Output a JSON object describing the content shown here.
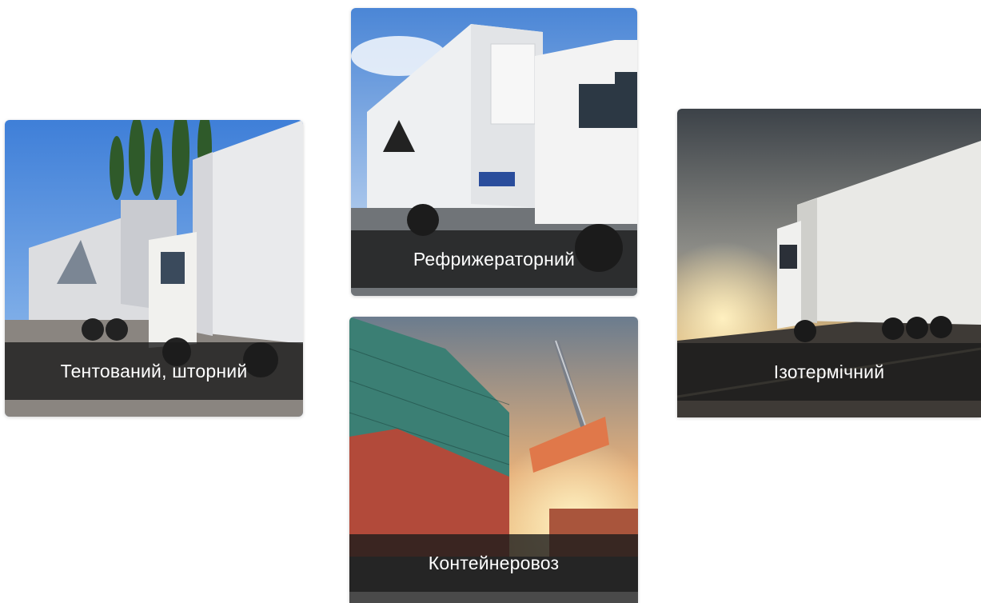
{
  "cards": [
    {
      "id": "tent",
      "label": "Тентований, шторний"
    },
    {
      "id": "refr",
      "label": "Рефрижераторний"
    },
    {
      "id": "cont",
      "label": "Контейнеровоз"
    },
    {
      "id": "iso",
      "label": "Ізотермічний"
    }
  ],
  "colors": {
    "caption_bg": "#1c1c1c",
    "caption_text": "#ffffff",
    "page_bg": "#ffffff"
  }
}
